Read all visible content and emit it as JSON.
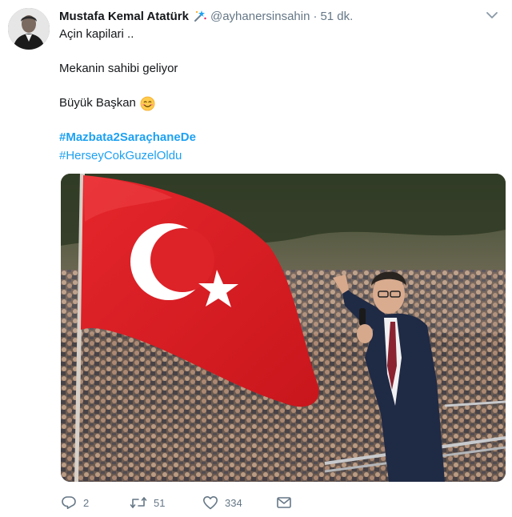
{
  "tweet": {
    "author_name": "Mustafa Kemal Atatürk",
    "handle": "@ayhanersinsahin",
    "separator": "·",
    "time": "51 dk.",
    "lines": {
      "l1": "Açin kapilari ..",
      "l2": "Mekanin sahibi geliyor",
      "l3": "Büyük Başkan"
    },
    "hashtags": [
      "#Mazbata2SaraçhaneDe",
      "#HerseyCokGuzelOldu"
    ],
    "media": {
      "description_icon": "photo"
    },
    "counts": {
      "replies": "2",
      "retweets": "51",
      "likes": "334"
    },
    "icons": {
      "reply": "reply-icon",
      "retweet": "retweet-icon",
      "like": "heart-icon",
      "dm": "envelope-icon",
      "caret": "chevron-down-icon",
      "badge": "stars-badge-icon",
      "emoji": "smiling-face-emoji"
    },
    "colors": {
      "link": "#1da1f2",
      "muted": "#657786",
      "text": "#14171a"
    }
  }
}
